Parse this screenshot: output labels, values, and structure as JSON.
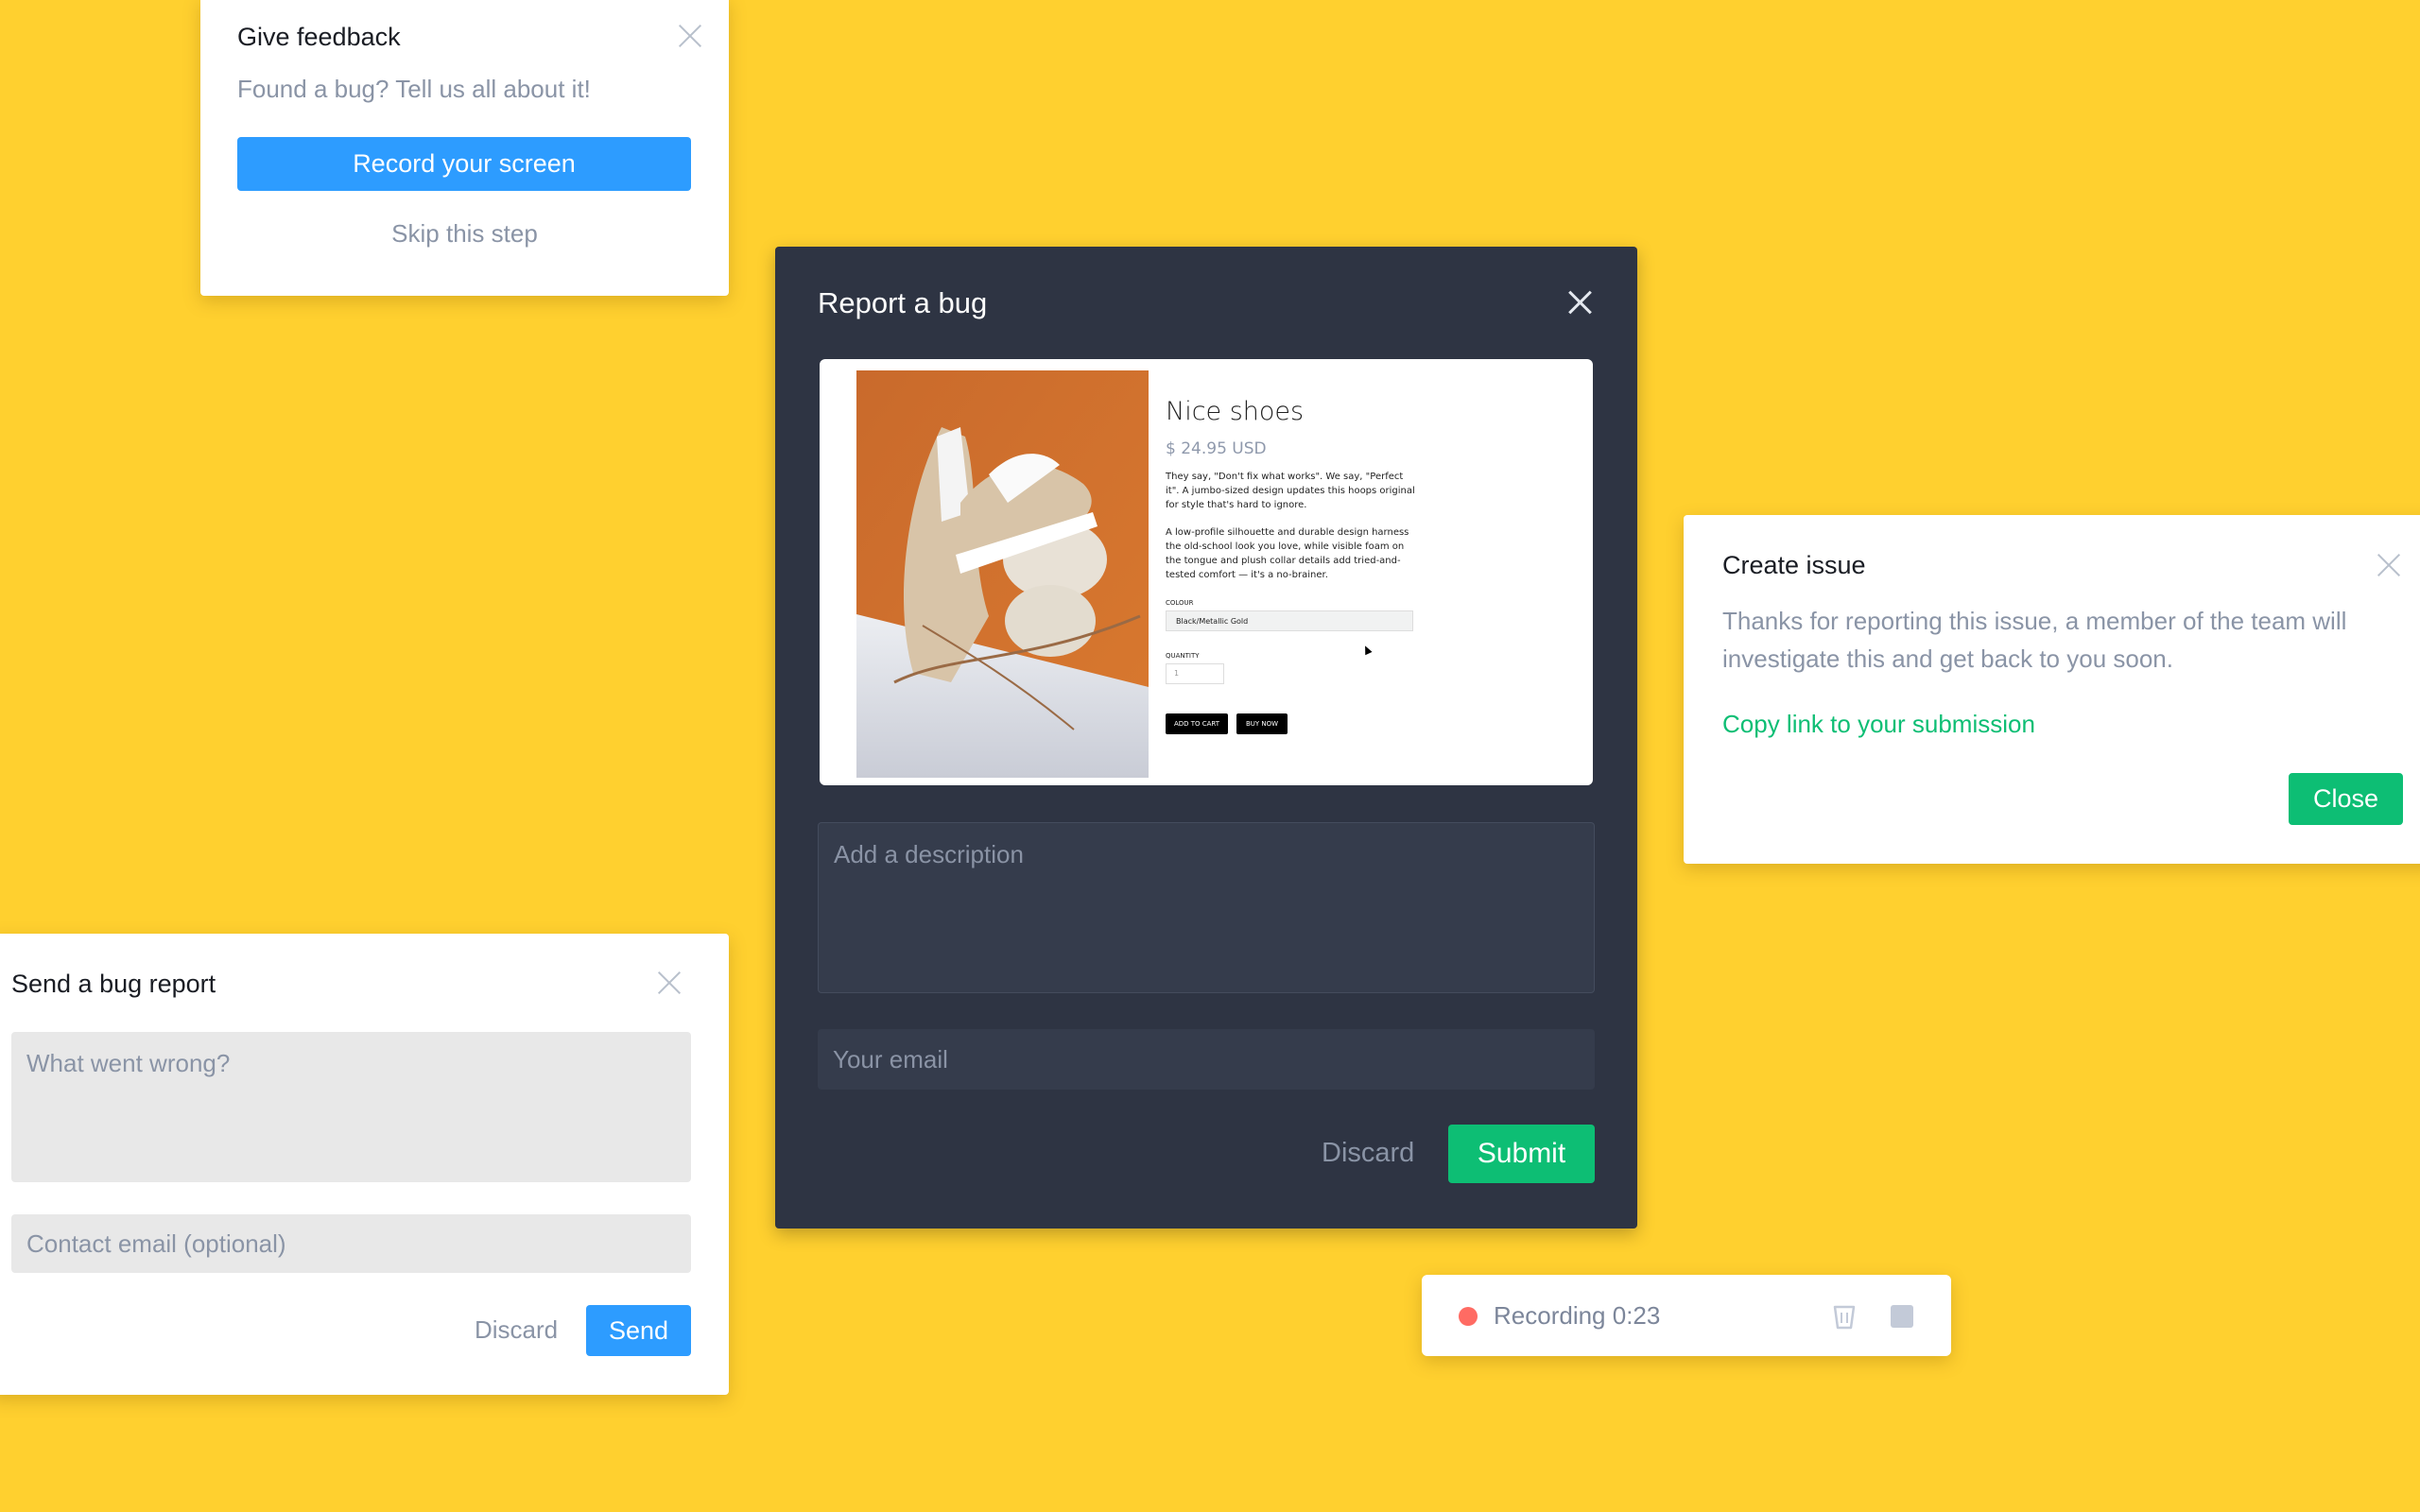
{
  "give_feedback": {
    "title": "Give feedback",
    "subtitle": "Found a bug? Tell us all about it!",
    "record_button": "Record your screen",
    "skip_link": "Skip this step",
    "accent": "#2D9CFF"
  },
  "report_bug": {
    "title": "Report a bug",
    "description_placeholder": "Add a description",
    "email_placeholder": "Your email",
    "discard_label": "Discard",
    "submit_label": "Submit",
    "background": "#2E3443",
    "submit_color": "#0DBE74",
    "preview": {
      "product_name": "Nice shoes",
      "price": "$ 24.95 USD",
      "paragraph1": "They say, \"Don't fix what works\". We say, \"Perfect it\". A jumbo-sized design updates this hoops original for style that's hard to ignore.",
      "paragraph2": "A low-profile silhouette and durable design harness the old-school look you love, while visible foam on the tongue and plush collar details add tried-and-tested comfort — it's a no-brainer.",
      "colour_label": "COLOUR",
      "colour_value": "Black/Metallic Gold",
      "quantity_label": "QUANTITY",
      "quantity_value": "1",
      "add_to_cart": "ADD TO CART",
      "buy_now": "BUY NOW"
    }
  },
  "create_issue": {
    "title": "Create issue",
    "message": "Thanks for reporting this issue, a member of the team will investigate this and get back to you soon.",
    "copy_link": "Copy link to your submission",
    "close_label": "Close",
    "accent": "#0DBE74"
  },
  "send_report": {
    "title": "Send a bug report",
    "description_placeholder": "What went wrong?",
    "email_placeholder": "Contact email (optional)",
    "discard_label": "Discard",
    "send_label": "Send"
  },
  "recording": {
    "label": "Recording 0:23",
    "dot_color": "#FF6B63",
    "icons": [
      "trash-icon",
      "stop-icon"
    ]
  }
}
